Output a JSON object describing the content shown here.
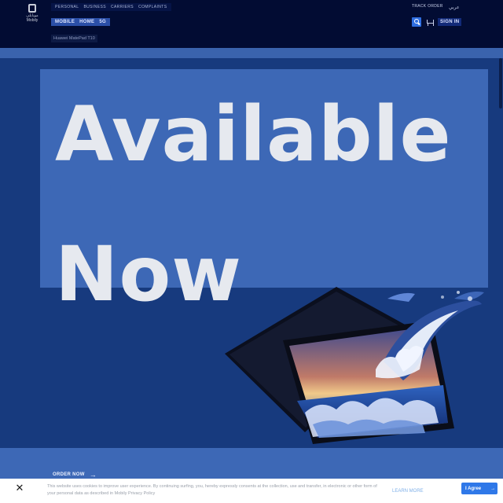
{
  "header": {
    "logo": {
      "arabic": "موبايلي",
      "english": "Mobily"
    },
    "top_nav": [
      "PERSONAL",
      "BUSINESS",
      "CARRIERS",
      "COMPLAINTS"
    ],
    "sub_nav": [
      "MOBILE",
      "HOME",
      "5G"
    ],
    "breadcrumb": "Huawei MatePad T10",
    "track_order": "TRACK ORDER",
    "language": "عربي",
    "sign_in": "SIGN IN"
  },
  "hero": {
    "headline": "Available\nNow",
    "order_now": "ORDER NOW",
    "order_arrow": "→"
  },
  "cookie_banner": {
    "close": "✕",
    "text": "This website uses cookies to improve user experience. By continuing surfing, you, hereby expressly consents at the collection, use and transfer, in electronic or other form of your personal data as described in Mobily Privacy Policy",
    "learn_more": "LEARN MORE",
    "agree": "I Agree",
    "agree_arrow": "→"
  },
  "icons": {
    "search": "search-icon",
    "cart": "cart-icon",
    "close": "close-icon"
  },
  "colors": {
    "header_bg": "#020c33",
    "hero_bg": "#173a7e",
    "headline_box": "#3d68b6",
    "accent_button": "#2f78e8"
  }
}
